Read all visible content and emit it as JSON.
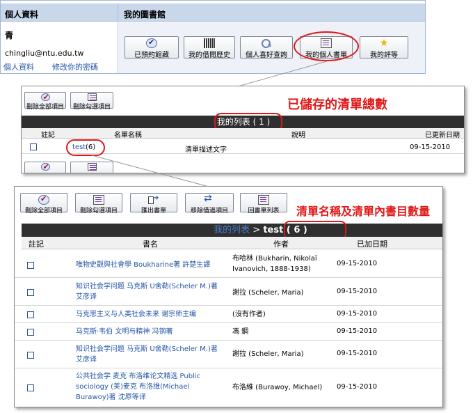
{
  "panel1": {
    "header_left": "個人資料",
    "header_right": "我的圖書館",
    "user_name_partial": "青",
    "email_partial": "chingliu@ntu.edu.tw",
    "link_profile": "個人資料",
    "link_password": "修改你的密碼",
    "buttons": [
      "已預約館藏",
      "我的借閱歷史",
      "個人喜好查詢",
      "我的個人書單",
      "我的評等"
    ]
  },
  "panel2": {
    "buttons": [
      "刪除全部項目",
      "刪除勾選項目"
    ],
    "annotation": "已儲存的清單總數",
    "bar_title": "我的列表 ( 1 )",
    "headers": {
      "note": "註記",
      "name": "名單名稱",
      "desc": "說明",
      "updated": "已更新日期"
    },
    "rows": [
      {
        "name": "test",
        "count": "(6)",
        "desc": "清單描述文字",
        "updated": "09-15-2010"
      }
    ]
  },
  "panel3": {
    "buttons": [
      "刪除全部項目",
      "刪除勾選項目",
      "匯出書單",
      "移除借過項目",
      "回書單列表"
    ],
    "annotation": "清單名稱及清單內書目數量",
    "breadcrumb_link": "我的列表",
    "breadcrumb_sep": " > ",
    "breadcrumb_current": "test ( 6 )",
    "headers": {
      "note": "註記",
      "title": "書名",
      "author": "作者",
      "added": "已加日期"
    },
    "rows": [
      {
        "title": "唯物史觀與社會學 Boukharine著 許楚生譯",
        "author": "布哈林 (Bukharin, Nikolaĭ Ivanovich, 1888-1938)",
        "added": "09-15-2010"
      },
      {
        "title": "知识社会学问题 马克斯 U舍勒(Scheler M.)著 艾彦译",
        "author": "謝拉 (Scheler, Maria)",
        "added": "09-15-2010"
      },
      {
        "title": "马克思主义与人类社会未来 谢宗师主编",
        "author": "(沒有作者)",
        "added": "09-15-2010"
      },
      {
        "title": "马克斯·韦伯 文明与精神 冯钢著",
        "author": "馮 鋼",
        "added": "09-15-2010"
      },
      {
        "title": "知识社会学问题 马克斯 U舍勒(Scheler M.)著 艾彦译",
        "author": "謝拉 (Scheler, Maria)",
        "added": "09-15-2010"
      },
      {
        "title": "公共社会学 麦克 布洛维论文精选 Public sociology (美)麦克 布洛维(Michael Burawoy)著 沈原等译",
        "author": "布洛維 (Burawoy, Michael)",
        "added": "09-15-2010"
      }
    ]
  },
  "colors": {
    "annotation_red": "#e01818",
    "link_blue": "#2456a8",
    "bar_dark": "#2f2f2f",
    "header_blue": "#c9d7ea"
  }
}
